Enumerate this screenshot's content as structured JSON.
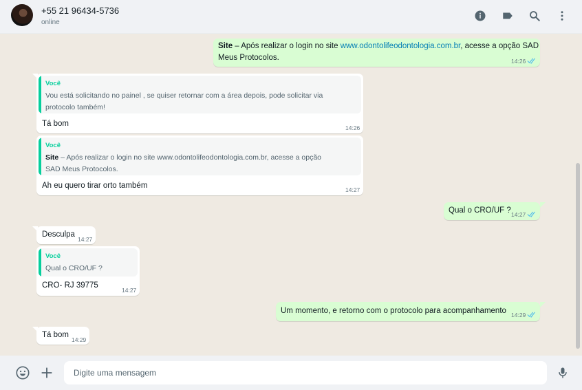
{
  "header": {
    "contact_name": "+55 21 96434-5736",
    "status": "online",
    "icons": [
      "info-icon",
      "label-icon",
      "search-icon",
      "more-vertical-icon"
    ]
  },
  "messages": [
    {
      "direction": "out",
      "prefix": "Site",
      "text_before_link": " – Após realizar o login no site ",
      "link": "www.odontolifeodontologia.com.br",
      "text_after_link": ", acesse a opção SAD",
      "line2": "Meus Protocolos.",
      "time": "14:26",
      "ticks": "read"
    },
    {
      "direction": "in",
      "quote_author": "Você",
      "quote_line1": "Vou está solicitando no painel , se quiser retornar com a área depois, pode solicitar via",
      "quote_line2": "protocolo também!",
      "text": "Tá bom",
      "time": "14:26"
    },
    {
      "direction": "in",
      "quote_author": "Você",
      "quote_prefix": "Site",
      "quote_line1": " – Após realizar o login no site www.odontolifeodontologia.com.br, acesse a opção",
      "quote_line2": "SAD Meus Protocolos.",
      "text": "Ah eu quero tirar orto também",
      "time": "14:27"
    },
    {
      "direction": "out",
      "text": "Qual o CRO/UF ?",
      "time": "14:27",
      "ticks": "read"
    },
    {
      "direction": "in",
      "text": "Desculpa",
      "time": "14:27"
    },
    {
      "direction": "in",
      "quote_author": "Você",
      "quote_line1": "Qual o CRO/UF ?",
      "text": "CRO- RJ 39775",
      "time": "14:27"
    },
    {
      "direction": "out",
      "text": "Um momento, e retorno com o protocolo para acompanhamento",
      "time": "14:29",
      "ticks": "read"
    },
    {
      "direction": "in",
      "text": "Tá bom",
      "time": "14:29"
    }
  ],
  "composer": {
    "placeholder": "Digite uma mensagem",
    "icons": [
      "emoji-icon",
      "attach-plus-icon",
      "microphone-icon"
    ]
  },
  "colors": {
    "incoming_bubble": "#ffffff",
    "outgoing_bubble": "#d9fdd3",
    "quote_accent": "#06cf9c",
    "link": "#027eb5",
    "read_ticks": "#53bdeb",
    "chat_background": "#efeae2"
  }
}
